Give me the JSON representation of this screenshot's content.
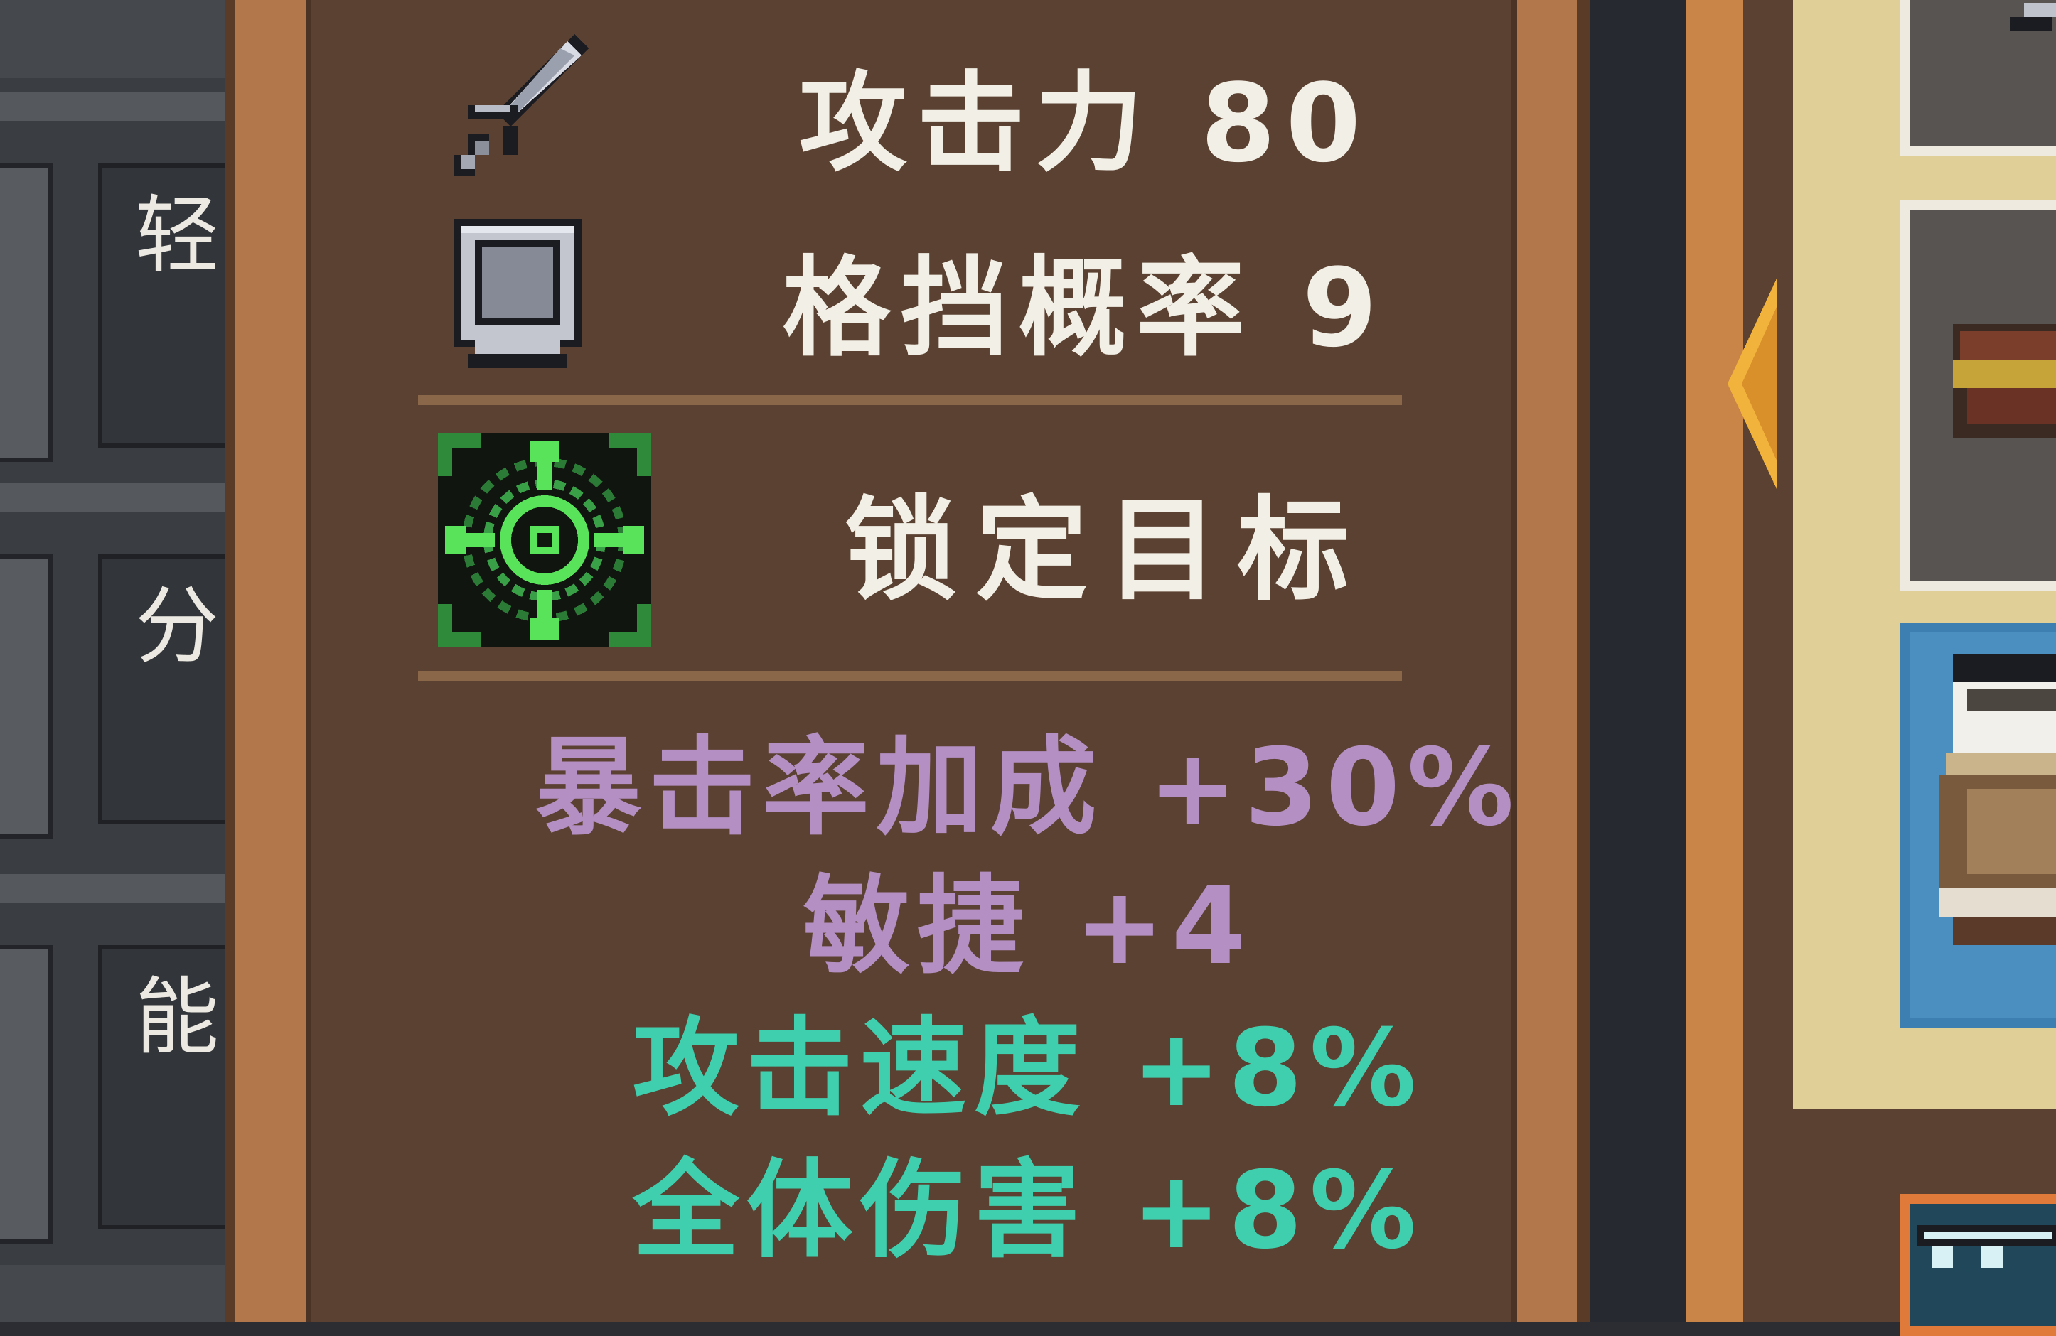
{
  "side_menu": {
    "items": [
      {
        "label": "轻"
      },
      {
        "label": "分"
      },
      {
        "label": "能"
      }
    ]
  },
  "tooltip": {
    "stats": [
      {
        "icon": "sword-icon",
        "label": "攻击力 80"
      },
      {
        "icon": "shield-icon",
        "label": "格挡概率 9"
      }
    ],
    "skill": {
      "icon": "target-lock-icon",
      "label": "锁定目标"
    },
    "bonuses": [
      {
        "label": "暴击率加成 +30%",
        "color": "#b48fc4"
      },
      {
        "label": "敏捷 +4",
        "color": "#b48fc4"
      },
      {
        "label": "攻击速度 +8%",
        "color": "#3fcfae"
      },
      {
        "label": "全体伤害 +8%",
        "color": "#3fcfae"
      }
    ]
  },
  "colors": {
    "panel_bg": "#5b4131",
    "frame": "#b2774a",
    "text_white": "#f2efe6",
    "text_purple": "#b48fc4",
    "text_teal": "#3fcfae",
    "accent_green": "#59e35a"
  }
}
